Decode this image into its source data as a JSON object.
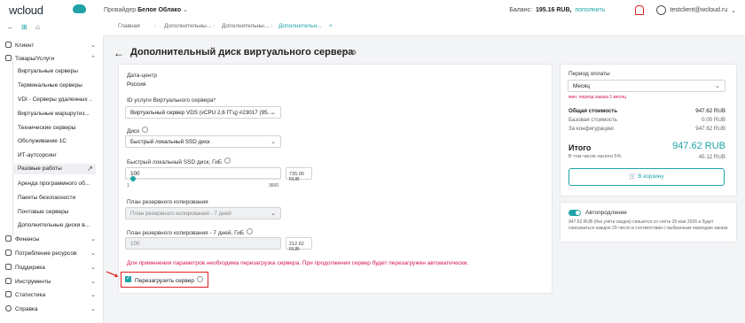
{
  "topbar": {
    "logo": "wcloud",
    "provider_label": "Провайдер",
    "provider_name": "Белое Облако",
    "provider_chevron": "⌄",
    "balance_label": "Баланс:",
    "balance_value": "195.16 RUB,",
    "topup_link": "пополнить",
    "user_email": "testclient@wcloud.ru",
    "user_chevron": "⌄",
    "icons": [
      "bell-icon",
      "user-icon"
    ],
    "accent_color": "#1fa3a6",
    "alert_color": "#dd2222"
  },
  "tabsbar": {
    "nav_icons": [
      "back-arrow-icon",
      "tree-icon",
      "home-icon"
    ],
    "nav_glyphs": [
      "←",
      "⊞",
      "⌂"
    ],
    "tabs": [
      {
        "label": "Главная"
      },
      {
        "label": "Дополнительны..."
      },
      {
        "label": "Дополнительны..."
      },
      {
        "label": "Дополнительн...",
        "active": true
      }
    ],
    "tab_close": "×"
  },
  "sidebar": {
    "items": [
      {
        "label": "Клиент",
        "chevron": "⌄"
      },
      {
        "label": "Товары/Услуги",
        "chevron": "⌃"
      }
    ],
    "subitems": [
      {
        "label": "Виртуальные серверы"
      },
      {
        "label": "Терминальные серверы"
      },
      {
        "label": "VDI - Серверы удаленных ..."
      },
      {
        "label": "Виртуальные маршрутиз..."
      },
      {
        "label": "Технические серверы"
      },
      {
        "label": "Обслуживание 1С"
      },
      {
        "label": "ИТ-аутсорсинг"
      },
      {
        "label": "Разовые работы",
        "active": true
      },
      {
        "label": "Аренда программного об..."
      },
      {
        "label": "Пакеты безопасности"
      },
      {
        "label": "Почтовые серверы"
      },
      {
        "label": "Дополнительные диски в..."
      }
    ],
    "open_new_icon": "↗",
    "bottom_items": [
      {
        "label": "Финансы",
        "chevron": "⌄"
      },
      {
        "label": "Потребление ресурсов",
        "chevron": "⌄"
      },
      {
        "label": "Поддержка",
        "chevron": "⌄"
      },
      {
        "label": "Инструменты",
        "chevron": "⌄"
      },
      {
        "label": "Статистика",
        "chevron": "⌄"
      },
      {
        "label": "Справка",
        "chevron": "⌄"
      }
    ]
  },
  "page": {
    "back_arrow": "←",
    "title": "Дополнительный диск виртуального сервера",
    "header_icons": "↻ ⚙"
  },
  "form": {
    "datacenter_label": "Дата-центр",
    "datacenter_value": "Россия",
    "service_label": "ID услуги Виртуального сервера*",
    "service_value": "Виртуальный сервер VDS (vCPU 2,6 ГГц) #23017 (95...",
    "disk_label": "Диск",
    "disk_value": "Быстрый локальный SSD диск",
    "size_label": "Быстрый локальный SSD диск, ГиБ",
    "size_value": "100",
    "size_price": "735.00 RUB",
    "slider_min": "1",
    "slider_max": "3600",
    "slider_fraction": 0.0275,
    "backup_plan_label": "План резервного копирования",
    "backup_plan_value": "План резервного копирования - 7 дней",
    "backup_size_label": "План резервного копирования - 7 дней, ГиБ",
    "backup_size_value": "100",
    "backup_price": "212.62 RUB",
    "warning": "Для применения параметров необходима перезагрузка сервера. При продолжении сервер будет перезагружен автоматически.",
    "reboot_label": "Перезагрузить сервер",
    "reboot_checked": true,
    "chevron": "⌄",
    "check_glyph": "✓"
  },
  "summary": {
    "period_label": "Период оплаты",
    "period_value": "Месяц",
    "period_note": "мин. период заказа 1 месяц",
    "total_cost_label": "Общая стоимость",
    "total_cost_value": "947.62 RUB",
    "base_cost_label": "Базовая стоимость",
    "base_cost_value": "0.00 RUB",
    "config_label": "За конфигурацию",
    "config_value": "947.62 RUB",
    "grand_label": "Итого",
    "grand_value": "947.62 RUB",
    "tax_label": "В том числе налоги 5%",
    "tax_value": "45.12 RUB",
    "cart_button": "В корзину",
    "cart_icon": "🛒",
    "autorenew_label": "Автопродление",
    "autorenew_on": true,
    "autorenew_text": "947.62 RUB (без учёта скидок) спишется со счёта 29 мая 2026 и будет списываться каждое 29 число в соответствии с выбранным периодом заказа"
  }
}
